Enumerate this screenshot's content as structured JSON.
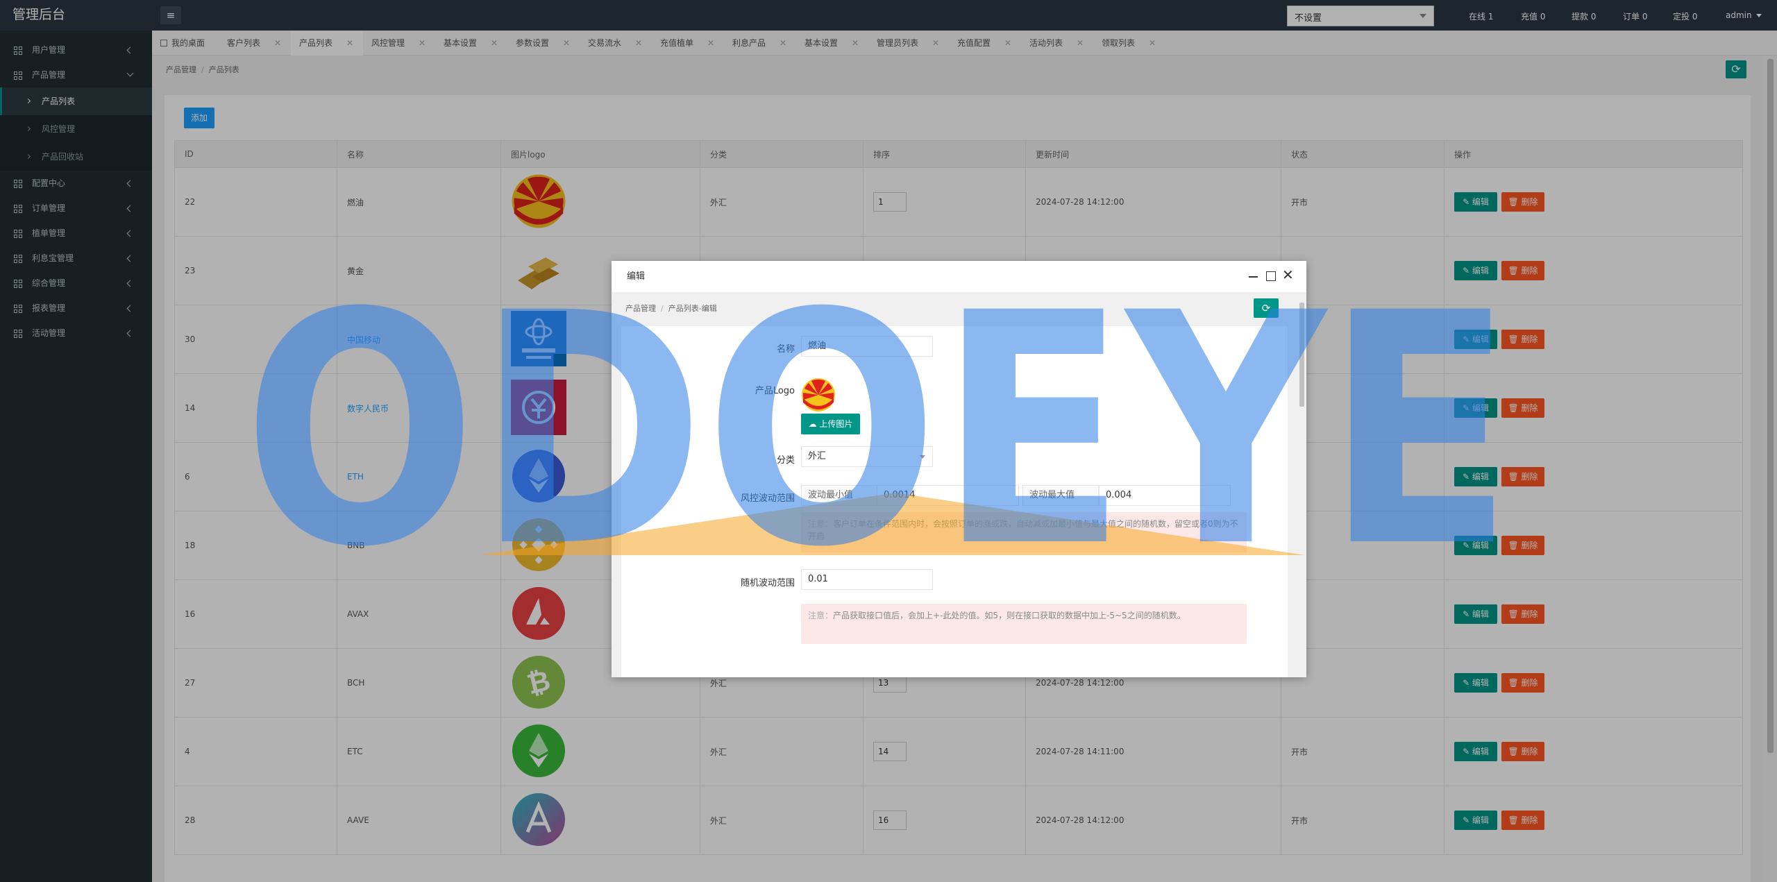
{
  "app": {
    "title": "管理后台",
    "menu_icon": "≡",
    "language_select": "不设置",
    "stats": {
      "online": "在线 1",
      "recharge": "充值 0",
      "withdraw": "提款 0",
      "orders": "订单 0",
      "fixed": "定投 0",
      "user": "admin"
    }
  },
  "sidebar": {
    "items": [
      {
        "label": "用户管理"
      },
      {
        "label": "产品管理"
      },
      {
        "label": "产品列表"
      },
      {
        "label": "风控管理"
      },
      {
        "label": "产品回收站"
      },
      {
        "label": "配置中心"
      },
      {
        "label": "订单管理"
      },
      {
        "label": "植单管理"
      },
      {
        "label": "利息宝管理"
      },
      {
        "label": "综合管理"
      },
      {
        "label": "报表管理"
      },
      {
        "label": "活动管理"
      }
    ]
  },
  "tabs": [
    {
      "label": "我的桌面"
    },
    {
      "label": "客户列表"
    },
    {
      "label": "产品列表"
    },
    {
      "label": "风控管理"
    },
    {
      "label": "基本设置"
    },
    {
      "label": "参数设置"
    },
    {
      "label": "交易流水"
    },
    {
      "label": "充值植单"
    },
    {
      "label": "利息产品"
    },
    {
      "label": "基本设置"
    },
    {
      "label": "管理员列表"
    },
    {
      "label": "充值配置"
    },
    {
      "label": "活动列表"
    },
    {
      "label": "领取列表"
    }
  ],
  "breadcrumb": {
    "parent": "产品管理",
    "current": "产品列表"
  },
  "toolbar": {
    "add_label": "添加",
    "refresh_icon": "⟳"
  },
  "table": {
    "headers": [
      "ID",
      "名称",
      "图片logo",
      "分类",
      "排序",
      "更新时间",
      "状态",
      "操作"
    ],
    "edit_label": "✎ 编辑",
    "delete_label": "🗑 删除",
    "rows": [
      {
        "id": "22",
        "name": "燃油",
        "logo": "petrochina",
        "category": "外汇",
        "sort": "1",
        "time": "2024-07-28 14:12:00",
        "status": "开市"
      },
      {
        "id": "23",
        "name": "黄金",
        "logo": "gold",
        "category": "",
        "sort": "",
        "time": "",
        "status": ""
      },
      {
        "id": "30",
        "name": "中国移动",
        "logo": "china-mobile",
        "category": "",
        "sort": "",
        "time": "",
        "status": ""
      },
      {
        "id": "14",
        "name": "数字人民币",
        "logo": "digital-rmb",
        "category": "",
        "sort": "",
        "time": "",
        "status": ""
      },
      {
        "id": "6",
        "name": "ETH",
        "logo": "eth",
        "category": "",
        "sort": "",
        "time": "",
        "status": ""
      },
      {
        "id": "18",
        "name": "BNB",
        "logo": "bnb",
        "category": "",
        "sort": "",
        "time": "",
        "status": ""
      },
      {
        "id": "16",
        "name": "AVAX",
        "logo": "avax",
        "category": "",
        "sort": "",
        "time": "",
        "status": ""
      },
      {
        "id": "27",
        "name": "BCH",
        "logo": "bch",
        "category": "外汇",
        "sort": "13",
        "time": "2024-07-28 14:12:00",
        "status": ""
      },
      {
        "id": "4",
        "name": "ETC",
        "logo": "etc",
        "category": "外汇",
        "sort": "14",
        "time": "2024-07-28 14:11:00",
        "status": "开市"
      },
      {
        "id": "28",
        "name": "AAVE",
        "logo": "aave",
        "category": "外汇",
        "sort": "16",
        "time": "2024-07-28 14:12:00",
        "status": "开市"
      }
    ]
  },
  "modal": {
    "title": "编辑",
    "breadcrumb_parent": "产品管理",
    "breadcrumb_current": "产品列表-编辑",
    "form": {
      "name_label": "名称",
      "name_value": "燃油",
      "logo_label": "产品Logo",
      "upload_label": "上传图片",
      "category_label": "分类",
      "category_value": "外汇",
      "risk_label": "风控波动范围",
      "min_label": "波动最小值",
      "min_value": "0.0014",
      "max_label": "波动最大值",
      "max_value": "0.004",
      "risk_note_prefix": "注意：",
      "risk_note": "客户订单在条件范围内时，会按照订单的涨或跌，自动减或加最小值与最大值之间的随机数，留空或者0则为不开启",
      "random_label": "随机波动范围",
      "random_value": "0.01",
      "random_note_prefix": "注意：",
      "random_note": "产品获取接口值后，会加上+-此处的值。如5，则在接口获取的数据中加上-5~5之间的随机数。"
    }
  },
  "watermark": {
    "text": "ODOEYE"
  },
  "colors": {
    "header": "#2a3744",
    "sidebar": "#222d32",
    "accent": "#009688",
    "add": "#1e9fff",
    "delete": "#ff5722"
  }
}
